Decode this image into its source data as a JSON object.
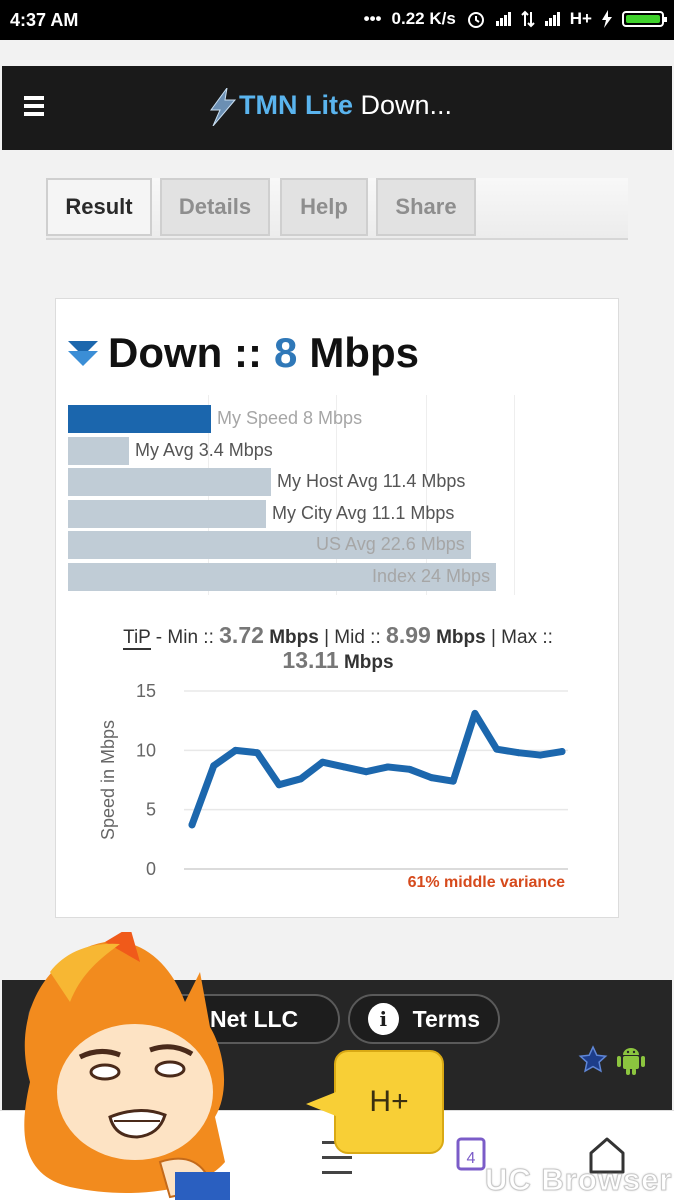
{
  "status_bar": {
    "time": "4:37 AM",
    "dots": "•••",
    "speed": "0.22 K/s",
    "network": "H+",
    "icons": [
      "alarm-icon",
      "signal-icon",
      "data-arrows-icon",
      "signal-icon",
      "charging-icon",
      "battery-icon"
    ]
  },
  "header": {
    "brand": "TMN Lite",
    "title": " Down..."
  },
  "tabs": [
    {
      "label": "Result"
    },
    {
      "label": "Details"
    },
    {
      "label": "Help"
    },
    {
      "label": "Share"
    }
  ],
  "result": {
    "direction": "Down ::",
    "speed": "8",
    "unit": "Mbps",
    "bars": [
      {
        "label": "My Speed 8 Mbps",
        "value": 8
      },
      {
        "label": "My Avg 3.4 Mbps",
        "value": 3.4
      },
      {
        "label": "My Host Avg 11.4 Mbps",
        "value": 11.4
      },
      {
        "label": "My City Avg 11.1 Mbps",
        "value": 11.1
      },
      {
        "label": "US Avg 22.6 Mbps",
        "value": 22.6
      },
      {
        "label": "Index 24 Mbps",
        "value": 24
      }
    ],
    "tip": {
      "abbr": "TiP",
      "min_label": " - Min :: ",
      "min": "3.72",
      "mid_label": " | Mid :: ",
      "mid": "8.99",
      "max_label": " | Max :: ",
      "max": "13.11",
      "unit": "Mbps"
    }
  },
  "chart_data": {
    "type": "line",
    "ylabel": "Speed in Mbps",
    "ylim": [
      0,
      15
    ],
    "yticks": [
      "0",
      "5",
      "10",
      "15"
    ],
    "annotation": "61% middle variance",
    "annotation_color": "#d64a1c",
    "line_color": "#1c67ad",
    "series": [
      {
        "values": [
          3.72,
          8.7,
          10.0,
          9.8,
          7.1,
          7.6,
          9.0,
          8.6,
          8.2,
          8.6,
          8.4,
          7.7,
          7.4,
          13.11,
          10.1,
          9.8,
          9.6,
          9.9
        ]
      }
    ]
  },
  "footer": {
    "net_label": "Net LLC",
    "terms_label": "Terms",
    "info_glyph": "i"
  },
  "toast": {
    "text": "H+"
  },
  "browser_nav": {
    "tab_count": "4",
    "brand": "UC Browser"
  },
  "colors": {
    "accent": "#2f78b8",
    "primary_bar": "#1b66ad",
    "compare_bar": "#c0ccd6",
    "header_bg": "#1a1a1a"
  }
}
